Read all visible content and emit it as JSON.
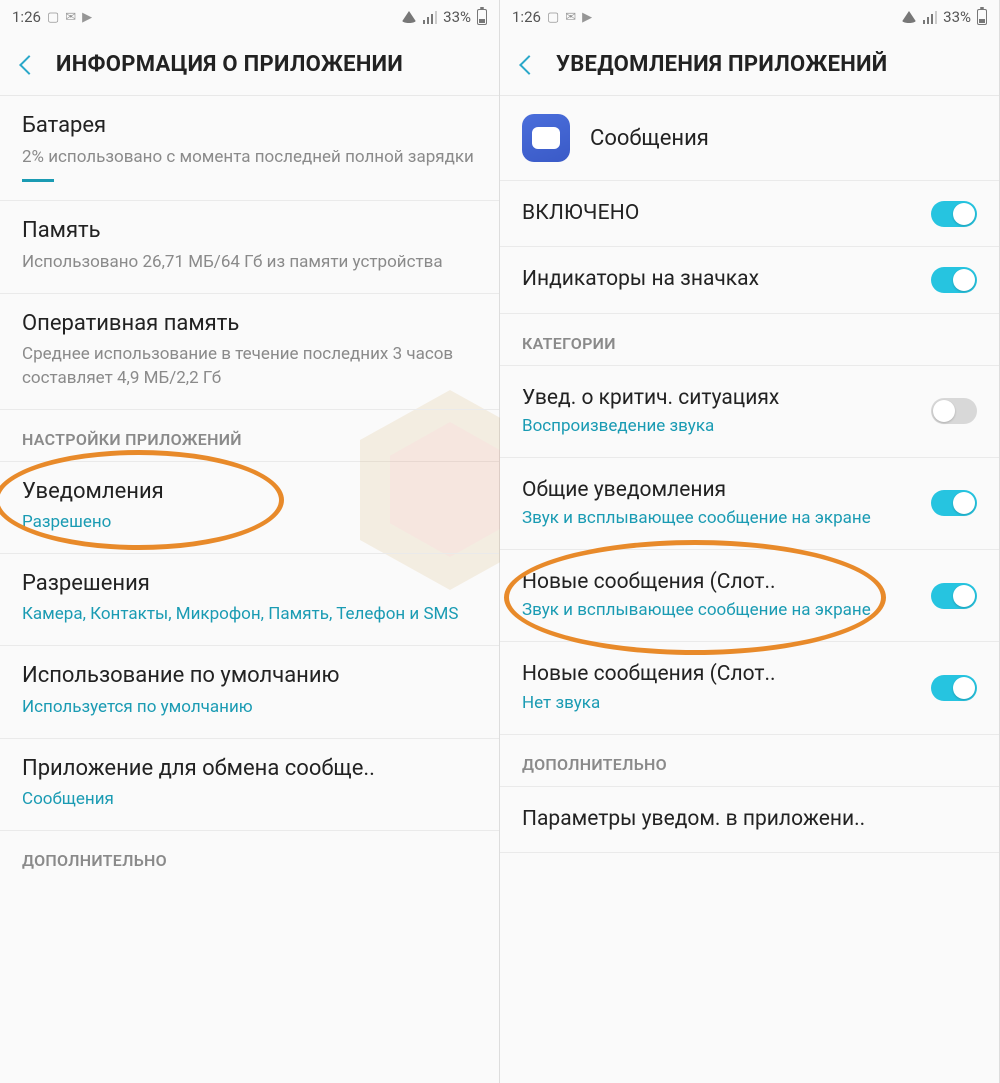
{
  "statusBar": {
    "time": "1:26",
    "batteryPct": "33%"
  },
  "left": {
    "headerTitle": "ИНФОРМАЦИЯ О ПРИЛОЖЕНИИ",
    "items": [
      {
        "title": "Батарея",
        "sub": "2% использовано с момента последней полной зарядки"
      },
      {
        "title": "Память",
        "sub": "Использовано 26,71 МБ/64 Гб из памяти устройства"
      },
      {
        "title": "Оперативная память",
        "sub": "Среднее использование в течение последних 3 часов составляет 4,9 МБ/2,2 Гб"
      }
    ],
    "sectionSettings": "НАСТРОЙКИ ПРИЛОЖЕНИЙ",
    "notifications": {
      "title": "Уведомления",
      "sub": "Разрешено"
    },
    "permissions": {
      "title": "Разрешения",
      "sub": "Камера, Контакты, Микрофон, Память, Телефон и SMS"
    },
    "defaultUse": {
      "title": "Использование по умолчанию",
      "sub": "Используется по умолчанию"
    },
    "msgApp": {
      "title": "Приложение для обмена сообще..",
      "sub": "Сообщения"
    },
    "sectionAdditional": "ДОПОЛНИТЕЛЬНО"
  },
  "right": {
    "headerTitle": "УВЕДОМЛЕНИЯ ПРИЛОЖЕНИЙ",
    "appName": "Сообщения",
    "enabled": {
      "title": "ВКЛЮЧЕНО",
      "on": true
    },
    "badges": {
      "title": "Индикаторы на значках",
      "on": true
    },
    "sectionCategories": "КАТЕГОРИИ",
    "categories": [
      {
        "title": "Увед. о критич. ситуациях",
        "sub_pre": "Воспроизведение ",
        "sub_hi": "звука",
        "on": false
      },
      {
        "title_pre": "Общие ",
        "title_hi": "уведомления",
        "sub": "Звук и всплывающее сообщение на экране",
        "on": true
      },
      {
        "title": "Новые сообщения (Слот..",
        "sub": "Звук и всплывающее сообщение на экране",
        "on": true
      },
      {
        "title": "Новые сообщения (Слот..",
        "sub": "Нет звука",
        "on": true
      }
    ],
    "sectionAdditional": "ДОПОЛНИТЕЛЬНО",
    "paramNotif": "Параметры уведом. в приложени.."
  }
}
